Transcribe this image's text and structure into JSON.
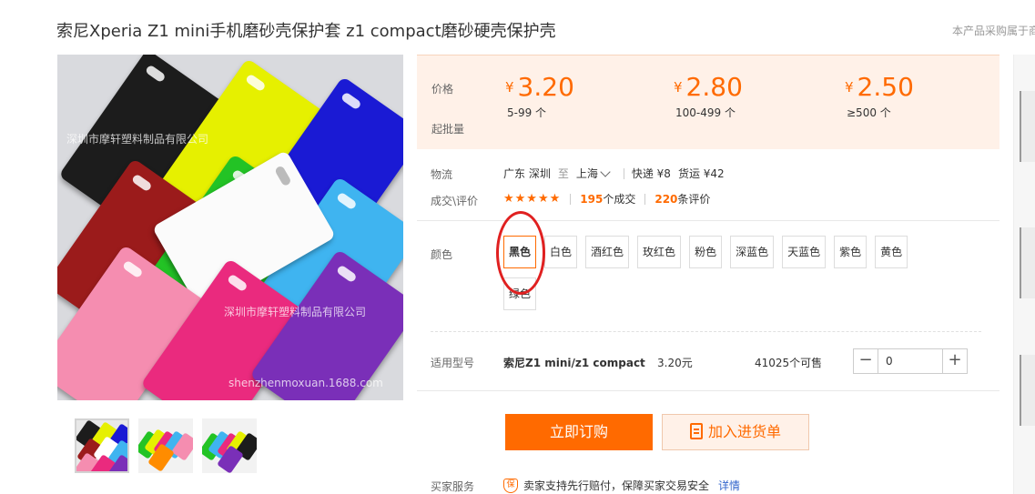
{
  "title": "索尼Xperia Z1 mini手机磨砂壳保护套 z1 compact磨砂硬壳保护壳",
  "top_note": "本产品采购属于商",
  "image": {
    "watermark_1": "深圳市摩轩塑料制品有限公司",
    "watermark_2": "深圳市摩轩塑料制品有限公司",
    "watermark_url": "shenzhenmoxuan.1688.com"
  },
  "price_section": {
    "price_label": "价格",
    "min_qty_label": "起批量",
    "currency": "¥",
    "tiers": [
      {
        "price": "3.20",
        "range": "5-99 个"
      },
      {
        "price": "2.80",
        "range": "100-499 个"
      },
      {
        "price": "2.50",
        "range": "≥500 个"
      }
    ]
  },
  "logistics": {
    "label": "物流",
    "origin": "广东 深圳",
    "to": "至",
    "destination": "上海",
    "express": "快递 ¥8",
    "freight": "货运 ¥42"
  },
  "reviews": {
    "label": "成交\\评价",
    "stars": "★★★★★",
    "deals_count": "195",
    "deals_text": "个成交",
    "review_count": "220",
    "review_text": "条评价"
  },
  "color": {
    "label": "颜色",
    "selected": "黑色",
    "options": [
      "黑色",
      "白色",
      "酒红色",
      "玫红色",
      "粉色",
      "深蓝色",
      "天蓝色",
      "紫色",
      "黄色",
      "绿色"
    ]
  },
  "model": {
    "label": "适用型号",
    "name": "索尼Z1 mini/z1 compact",
    "price": "3.20元",
    "stock": "41025个可售",
    "quantity": "0",
    "minus": "−",
    "plus": "+"
  },
  "actions": {
    "buy_label": "立即订购",
    "cart_label": "加入进货单"
  },
  "service": {
    "label": "买家服务",
    "badge": "保",
    "text": "卖家支持先行赔付，保障买家交易安全",
    "link": "详情"
  },
  "colors": {
    "accent": "#ff6a00",
    "price_bg": "#fff1e8",
    "annotation_ring": "#e02020"
  }
}
